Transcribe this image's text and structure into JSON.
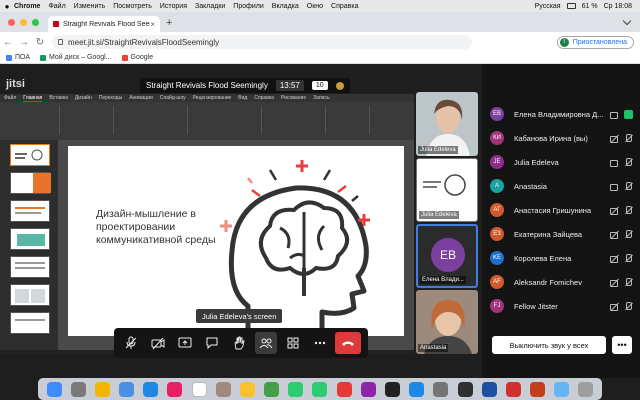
{
  "menubar": {
    "app": "Chrome",
    "items": [
      "Файл",
      "Изменить",
      "Посмотреть",
      "История",
      "Закладки",
      "Профили",
      "Вкладка",
      "Окно",
      "Справка"
    ],
    "input_language": "Русская",
    "battery": "61 %",
    "clock": "Ср 18:08"
  },
  "browser": {
    "tab_title": "Straight Revivals Flood Seemingly",
    "url": "meet.jit.si/StraightRevivalsFloodSeemingly",
    "profile_initial": "I",
    "profile_status": "Приостановлена",
    "bookmarks": [
      {
        "label": "ПОА",
        "color": "#4285f4"
      },
      {
        "label": "Мой диск – Googl...",
        "color": "#0f9d58"
      },
      {
        "label": "Google",
        "color": "#ea4335"
      }
    ]
  },
  "meeting": {
    "logo": "jitsi",
    "title": "Straight Revivals Flood Seemingly",
    "timer": "13:57",
    "participant_count": "10",
    "screen_label": "Julia Edeleva's screen",
    "slide_text": "Дизайн-мышление в проектировании коммуникативной среды",
    "filmstrip": [
      {
        "name": "Julia Edeleva",
        "kind": "photo"
      },
      {
        "name": "Julia Edeleva",
        "kind": "screen"
      },
      {
        "name": "Елена Влади...",
        "kind": "avatar",
        "initials": "EB",
        "color": "#7b3fa0"
      },
      {
        "name": "Anastasia",
        "kind": "photo"
      }
    ],
    "participants": [
      {
        "initials": "EB",
        "name": "Елена Владимировна Д...",
        "color": "#7b3fa0",
        "talking": true
      },
      {
        "initials": "КИ",
        "name": "Кабанова Ирина (вы)",
        "color": "#a0337a",
        "talking": false
      },
      {
        "initials": "JE",
        "name": "Julia Edeleva",
        "color": "#8e2d8e",
        "talking": false
      },
      {
        "initials": "A",
        "name": "Anastasia",
        "color": "#1aa2a0",
        "talking": false
      },
      {
        "initials": "AГ",
        "name": "Анастасия Гришунина",
        "color": "#d2592c",
        "talking": false
      },
      {
        "initials": "ЕЗ",
        "name": "Екатерина Зайцева",
        "color": "#d2592c",
        "talking": false
      },
      {
        "initials": "KE",
        "name": "Королева Елена",
        "color": "#1f6fd1",
        "talking": false
      },
      {
        "initials": "AF",
        "name": "Aleksandr Fomichev",
        "color": "#d2592c",
        "talking": false
      },
      {
        "initials": "FJ",
        "name": "Fellow Jitster",
        "color": "#a0337a",
        "talking": false
      }
    ],
    "mute_all_label": "Выключить звук у всех",
    "more_label": "•••"
  },
  "ppt": {
    "tabs": [
      "Файл",
      "Главная",
      "Вставка",
      "Дизайн",
      "Переходы",
      "Анимации",
      "Слайд-шоу",
      "Рецензирование",
      "Вид",
      "Справка",
      "Рисование",
      "Запись"
    ],
    "active_tab": "Главная"
  },
  "dock_apps": [
    {
      "name": "finder-icon",
      "color": "#3d8bfd"
    },
    {
      "name": "launchpad-icon",
      "color": "#7a7a7a"
    },
    {
      "name": "chrome-icon",
      "color": "#f4b400"
    },
    {
      "name": "mail-icon",
      "color": "#4a90e2"
    },
    {
      "name": "safari-icon",
      "color": "#1e88e5"
    },
    {
      "name": "photos-icon",
      "color": "#e91e63"
    },
    {
      "name": "calendar-icon",
      "color": "#ffffff"
    },
    {
      "name": "contacts-icon",
      "color": "#a1887f"
    },
    {
      "name": "notes-icon",
      "color": "#fbc02d"
    },
    {
      "name": "maps-icon",
      "color": "#43a047"
    },
    {
      "name": "facetime-icon",
      "color": "#2ecc71"
    },
    {
      "name": "messages-icon",
      "color": "#2ecc71"
    },
    {
      "name": "music-icon",
      "color": "#e53935"
    },
    {
      "name": "podcasts-icon",
      "color": "#8e24aa"
    },
    {
      "name": "tv-icon",
      "color": "#212121"
    },
    {
      "name": "appstore-icon",
      "color": "#1e88e5"
    },
    {
      "name": "settings-icon",
      "color": "#757575"
    },
    {
      "name": "obs-icon",
      "color": "#303030"
    },
    {
      "name": "word-icon",
      "color": "#1e4fa3"
    },
    {
      "name": "pdf-icon",
      "color": "#d32f2f"
    },
    {
      "name": "powerpoint-icon",
      "color": "#c43e1c"
    },
    {
      "name": "downloads-icon",
      "color": "#64b5f6"
    },
    {
      "name": "trash-icon",
      "color": "#9e9e9e"
    }
  ]
}
